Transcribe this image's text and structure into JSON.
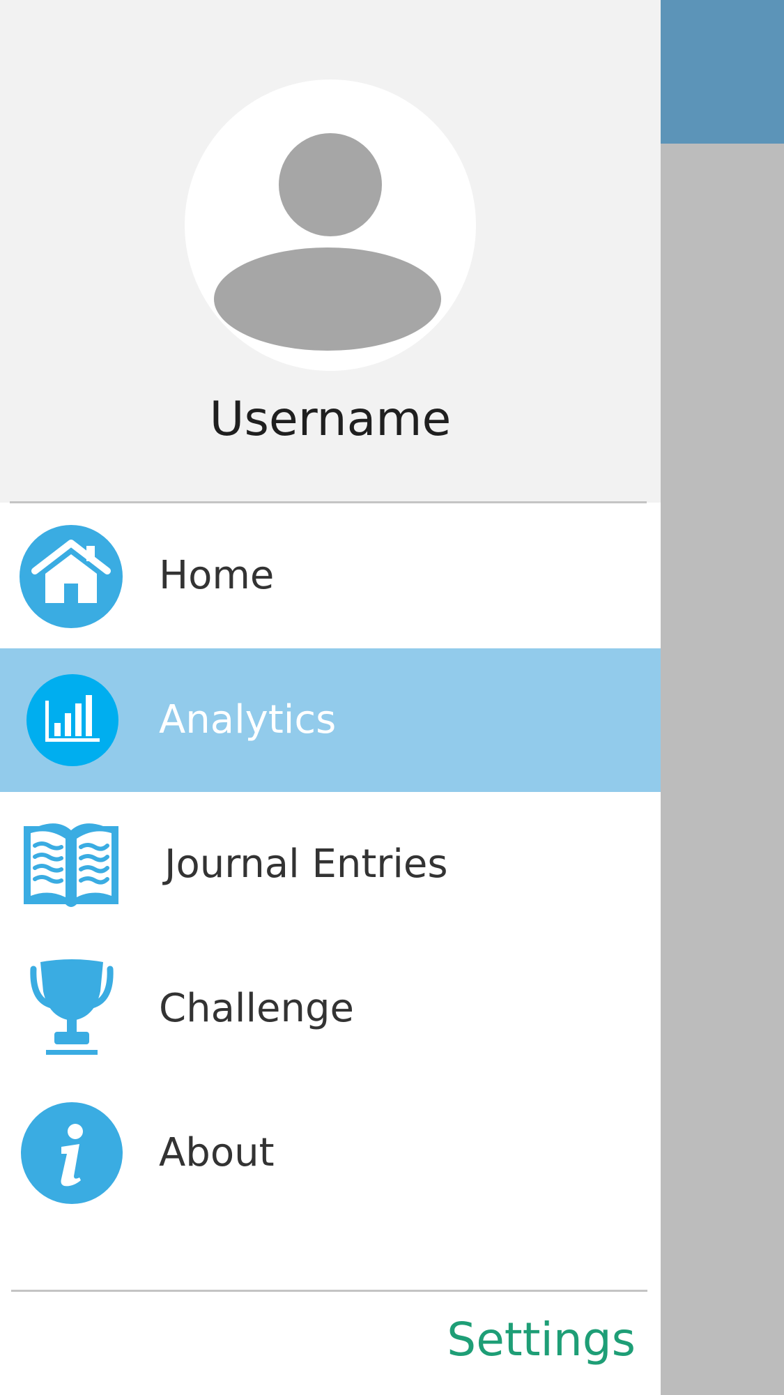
{
  "profile": {
    "avatar_icon": "user-avatar-icon",
    "username": "Username"
  },
  "menu": {
    "items": [
      {
        "label": "Home",
        "icon": "home-icon",
        "active": false
      },
      {
        "label": "Analytics",
        "icon": "analytics-icon",
        "active": true
      },
      {
        "label": "Journal Entries",
        "icon": "open-book-icon",
        "active": false
      },
      {
        "label": "Challenge",
        "icon": "trophy-icon",
        "active": false
      },
      {
        "label": "About",
        "icon": "info-icon",
        "active": false
      }
    ]
  },
  "footer": {
    "settings_label": "Settings"
  },
  "colors": {
    "accent_blue": "#3aace2",
    "active_blue": "#92cbeb",
    "settings_green": "#1e9e76",
    "header_blue": "#5c94b8"
  }
}
